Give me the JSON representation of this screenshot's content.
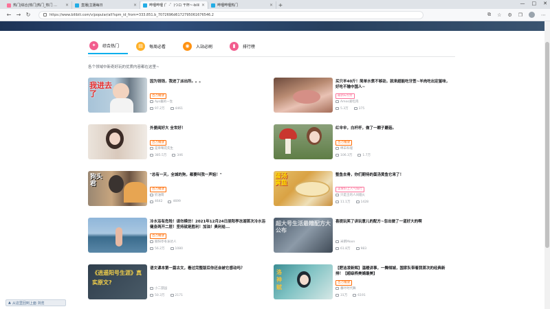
{
  "browser": {
    "tabs": [
      {
        "title": "热门|综合|热门|热门_热门 ...",
        "active": false
      },
      {
        "title": "直播|主播每日",
        "active": false
      },
      {
        "title": "哔哩哔哩 (゜-゜)つロ 干杯~-bilibili",
        "active": true
      },
      {
        "title": "哔哩哔哩热门",
        "active": false
      }
    ],
    "url": "https://www.bilibili.com/v/popular/all?spm_id_from=333.851.b_7072696d6172795061676546.2"
  },
  "nav": {
    "tabs": [
      {
        "label": "综合热门",
        "color": "#f25d8e",
        "icon": "fire-icon"
      },
      {
        "label": "每周必看",
        "color": "#ffb027",
        "icon": "calendar-icon"
      },
      {
        "label": "入站必刷",
        "color": "#ff9212",
        "icon": "medal-icon"
      },
      {
        "label": "排行榜",
        "color": "#f25d8e",
        "icon": "ranking-icon"
      }
    ],
    "subtitle": "各个领域中新奇好玩的优质内容都在这里~"
  },
  "cards": [
    {
      "title": "因为钱钱，我进了派出所。。。",
      "tag": "百万播放",
      "uploader": "Ayo酱的一生",
      "views": "97.2万",
      "comments": "4461",
      "thumb_text": "我进去了"
    },
    {
      "title": "买只羊40斤！简单水煮不够劲，就来超能吃牙签~羊肉吃出定鉴味，好吃不输中国人~",
      "tag": "最新&点赞",
      "uploader": "Amoo爱吃肉",
      "views": "5.3万",
      "comments": "375",
      "thumb_text": ""
    },
    {
      "title": "外婆阅好大 全世好！",
      "tag": "百万播放",
      "uploader": "是草莓花先生",
      "views": "385.5万",
      "comments": "346",
      "thumb_text": ""
    },
    {
      "title": "红伞伞，白杆杆，做了一颗子蘑菇。",
      "tag": "百万播放",
      "uploader": "绵羊料理",
      "views": "106.3万",
      "comments": "1.7万",
      "thumb_text": ""
    },
    {
      "title": "\"总有一天，全城的狗，都要叫我一声姐！\"",
      "tag": "百万播放",
      "uploader": "奶油萌",
      "views": "4642",
      "comments": "4699",
      "thumb_text": "狗头君"
    },
    {
      "title": "整鱼去骨，你们期待的蛋汤黄鱼它来了！",
      "tag": "美食好上人气排行",
      "uploader": "只是王的人间烟火",
      "views": "11.1万",
      "comments": "1428",
      "thumb_text": "蛋汤黄鱼"
    },
    {
      "title": "冷水浴有危险！请勿模仿！2021年12月24日朋阳亭冻湖首次冷水浴健身两开二层！坚持就是胜利！加油！奥利给...",
      "tag": "百万播放",
      "uploader": "朋阳亭冬泳达人",
      "views": "56.2万",
      "comments": "1080",
      "thumb_text": ""
    },
    {
      "title": "喜提玩笑了讲玩意儿的配方~忽出做了一道好大的啊",
      "tag": "",
      "uploader": "米粥Moon",
      "views": "61.8万",
      "comments": "983",
      "thumb_text": "超大号生活最糟配方大公布"
    },
    {
      "title": "语文课本第一篇古文，看过完整版后你还会被它感动吗？",
      "tag": "",
      "uploader": "小二游园",
      "views": "50.3万",
      "comments": "2171",
      "thumb_text": "《逍遥阳号生涯》真实原文?"
    },
    {
      "title": "【肥洁凌新辉】温暖讲事，一舞倾城，国家队带着我首次的经典新排！【超级杨美娟最美】",
      "tag": "百万播放",
      "uploader": "番叶时代舞",
      "views": "31万",
      "comments": "6191",
      "thumb_text": "洛神赋"
    }
  ],
  "floating_button": "从这里回到上面 浏览"
}
